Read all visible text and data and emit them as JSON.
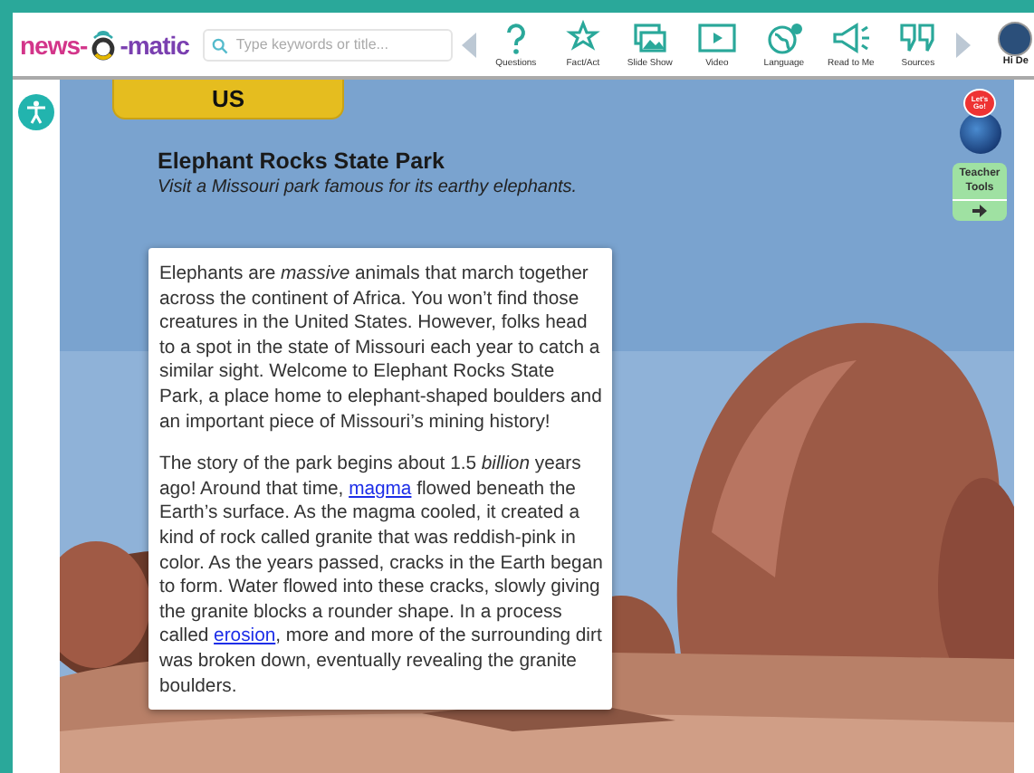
{
  "logo": {
    "left": "news-",
    "right": "-matic"
  },
  "search": {
    "placeholder": "Type keywords or title..."
  },
  "tools": [
    {
      "label": "Questions",
      "kind": "question"
    },
    {
      "label": "Fact/Act",
      "kind": "star"
    },
    {
      "label": "Slide Show",
      "kind": "photos"
    },
    {
      "label": "Video",
      "kind": "video"
    },
    {
      "label": "Language",
      "kind": "globe"
    },
    {
      "label": "Read to Me",
      "kind": "megaphone"
    },
    {
      "label": "Sources",
      "kind": "quote"
    }
  ],
  "user": {
    "greeting": "Hi De"
  },
  "section_tab": "US",
  "article": {
    "title": "Elephant Rocks State Park",
    "subtitle": "Visit a Missouri park famous for its earthy elephants.",
    "paragraphs": [
      [
        {
          "kind": "text",
          "text": "Elephants are *massive* animals that march together across the continent of Africa. You won’t find those creatures in the United States. However, folks head to a spot in the state of Missouri each year to catch a similar sight. Welcome to Elephant Rocks State Park, a place home to elephant-shaped boulders and an important piece of Missouri’s mining history!"
        }
      ],
      [
        {
          "kind": "text",
          "text": "The story of the park begins about 1.5 *billion* years ago! Around that time, "
        },
        {
          "kind": "link",
          "text": "magma"
        },
        {
          "kind": "text",
          "text": " flowed beneath the Earth’s surface. As the magma cooled, it created a kind of rock called granite that was reddish-pink in color. As the years passed, cracks in the Earth began to form. Water flowed into these cracks, slowly giving the granite blocks a rounder shape. In a process called "
        },
        {
          "kind": "link",
          "text": "erosion"
        },
        {
          "kind": "text",
          "text": ", more and more of the surrounding dirt was broken down, eventually revealing the granite boulders."
        }
      ]
    ]
  },
  "lets_go": "Let’s Go!",
  "teacher_tools": {
    "label": "Teacher Tools"
  }
}
